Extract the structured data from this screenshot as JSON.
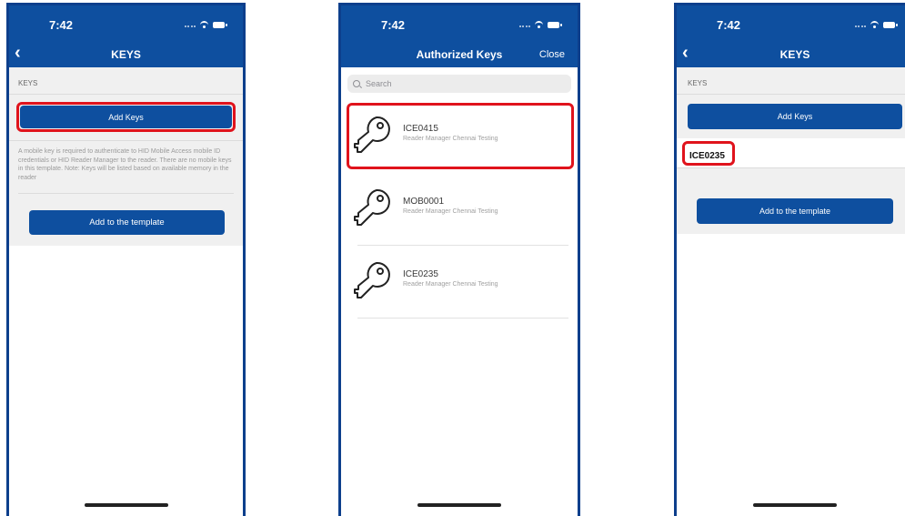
{
  "status_bar": {
    "time": "7:42"
  },
  "screen1": {
    "title": "KEYS",
    "section_label": "KEYS",
    "add_keys_label": "Add Keys",
    "description": "A mobile key is required to authenticate to HID Mobile Access mobile ID credentials or HID Reader Manager to the reader. There are no mobile keys in this template. Note: Keys will be listed based on available memory in the reader",
    "add_template_label": "Add to the template"
  },
  "screen2": {
    "title": "Authorized Keys",
    "close_label": "Close",
    "search_placeholder": "Search",
    "keys": [
      {
        "id": "ICE0415",
        "subtitle": "Reader Manager Chennai Testing",
        "highlighted": true
      },
      {
        "id": "MOB0001",
        "subtitle": "Reader Manager Chennai Testing",
        "highlighted": false
      },
      {
        "id": "ICE0235",
        "subtitle": "Reader Manager Chennai Testing",
        "highlighted": false
      }
    ]
  },
  "screen3": {
    "title": "KEYS",
    "section_label": "KEYS",
    "add_keys_label": "Add Keys",
    "added_key": "ICE0235",
    "add_template_label": "Add to the template"
  },
  "colors": {
    "header_blue": "#0e4f9f",
    "frame_blue": "#0d3f8c",
    "highlight_red": "#e0131c"
  },
  "icons": [
    "back-chevron-icon",
    "search-icon",
    "key-icon",
    "wifi-icon",
    "battery-icon"
  ]
}
